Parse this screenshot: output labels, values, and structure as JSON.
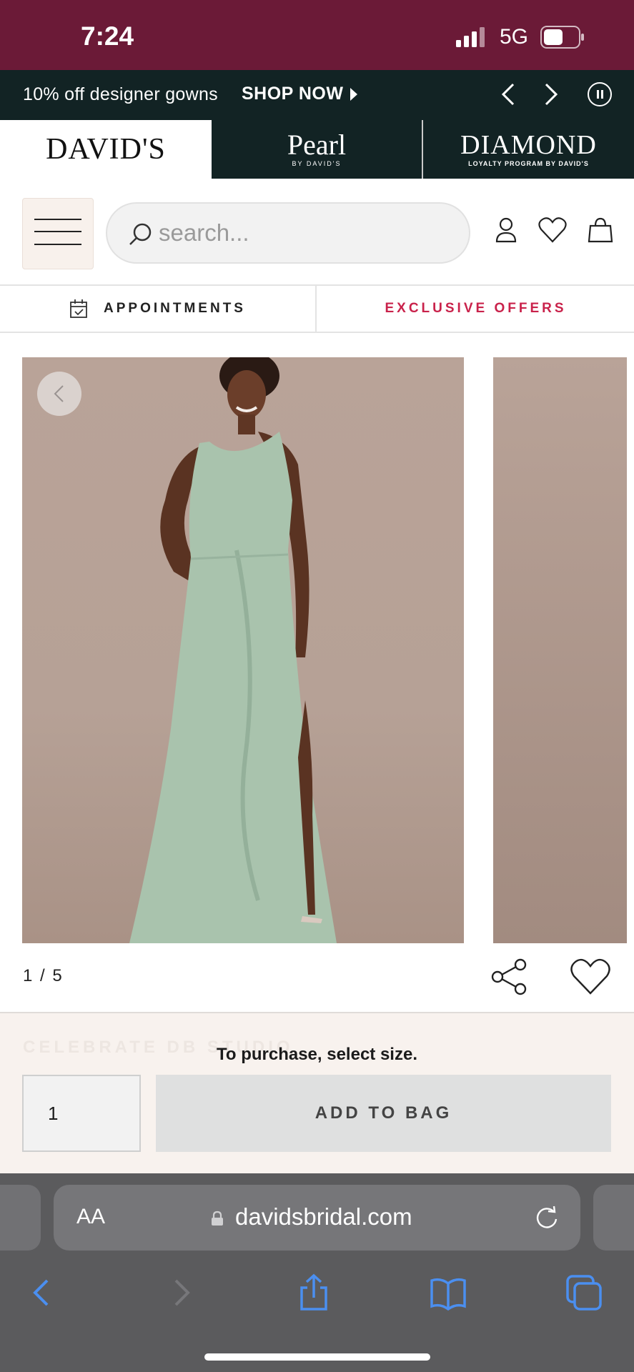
{
  "status_bar": {
    "time": "7:24",
    "network": "5G"
  },
  "promo": {
    "text": "10% off designer gowns",
    "link_label": "SHOP NOW"
  },
  "brands": {
    "davids": "DAVID'S",
    "pearl": "Pearl",
    "pearl_sub": "BY DAVID'S",
    "diamond": "DIAMOND",
    "diamond_sub": "LOYALTY PROGRAM BY DAVID'S"
  },
  "header": {
    "search_placeholder": "search..."
  },
  "subnav": {
    "appointments": "APPOINTMENTS",
    "offers": "EXCLUSIVE OFFERS"
  },
  "gallery": {
    "counter": "1 / 5"
  },
  "purchase": {
    "note": "To purchase, select size.",
    "quantity": "1",
    "add_to_bag": "ADD TO BAG",
    "ghost_heading": "CELEBRATE DB STUDIO"
  },
  "browser": {
    "aa_label": "AA",
    "url": "davidsbridal.com"
  },
  "colors": {
    "status_bg": "#6b1a37",
    "promo_bg": "#122324",
    "offers_accent": "#c9224b",
    "purchase_bg": "#f8f2ee",
    "dress": "#a9c3ad"
  }
}
